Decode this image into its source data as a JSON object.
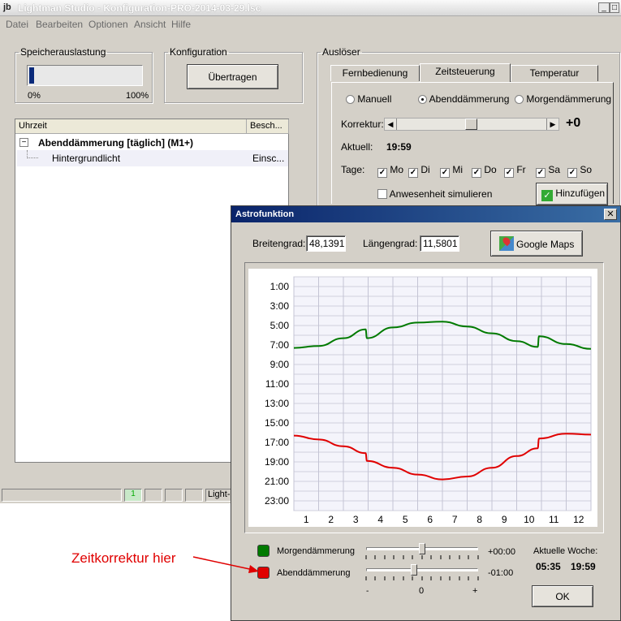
{
  "app": {
    "title": "Lightman Studio - Konfiguration-PRO-2014-03-29.lsc",
    "logo": "jb"
  },
  "menu": [
    "Datei",
    "Bearbeiten",
    "Optionen",
    "Ansicht",
    "Hilfe"
  ],
  "memory": {
    "legend": "Speicherauslastung",
    "min": "0%",
    "max": "100%",
    "usage": 0.04
  },
  "config": {
    "legend": "Konfiguration",
    "button": "Übertragen"
  },
  "list": {
    "headers": [
      "Uhrzeit",
      "Besch..."
    ],
    "group": "Abenddämmerung [täglich] (M1+)",
    "collapse": "−",
    "row": {
      "name": "Hintergrundlicht",
      "desc": "Einsc..."
    }
  },
  "status": {
    "indicator": "1",
    "text": "Light-I"
  },
  "trigger": {
    "legend": "Auslöser",
    "tabs": [
      "Fernbedienung",
      "Zeitsteuerung",
      "Temperatur"
    ],
    "modes": [
      "Manuell",
      "Abenddämmerung",
      "Morgendämmerung"
    ],
    "correction_label": "Korrektur:",
    "correction_value": "+0",
    "current_label": "Aktuell:",
    "current_value": "19:59",
    "days_label": "Tage:",
    "days": [
      "Mo",
      "Di",
      "Mi",
      "Do",
      "Fr",
      "Sa",
      "So"
    ],
    "simulate": "Anwesenheit simulieren",
    "add_button": "Hinzufügen"
  },
  "dialog": {
    "title": "Astrofunktion",
    "lat_label": "Breitengrad:",
    "lat": "48,1391",
    "lon_label": "Längengrad:",
    "lon": "11,5801",
    "maps_button": "Google Maps",
    "legend_morning": "Morgendämmerung",
    "legend_evening": "Abenddämmerung",
    "morning_offset": "+00:00",
    "evening_offset": "-01:00",
    "scale_minus": "-",
    "scale_zero": "0",
    "scale_plus": "+",
    "week_label": "Aktuelle Woche:",
    "week_morning": "05:35",
    "week_evening": "19:59",
    "ok": "OK"
  },
  "annotation": "Zeitkorrektur hier",
  "colors": {
    "morning": "#007a00",
    "evening": "#e00000",
    "annotation": "#e00000",
    "titlebar": "#0a246a"
  },
  "chart_data": {
    "type": "line",
    "x_ticks": [
      1,
      2,
      3,
      4,
      5,
      6,
      7,
      8,
      9,
      10,
      11,
      12
    ],
    "y_ticks": [
      "1:00",
      "3:00",
      "5:00",
      "7:00",
      "9:00",
      "11:00",
      "13:00",
      "15:00",
      "17:00",
      "19:00",
      "21:00",
      "23:00"
    ],
    "ylim": [
      0,
      24
    ],
    "xlim": [
      0.5,
      12.5
    ],
    "series": [
      {
        "key": "morning",
        "x": [
          0.5,
          1.5,
          2.5,
          3.4,
          3.45,
          4.5,
          5.5,
          6.5,
          7.5,
          8.5,
          9.5,
          10.35,
          10.4,
          11.5,
          12.5
        ],
        "y": [
          7.3,
          7.1,
          6.3,
          5.4,
          6.3,
          5.2,
          4.7,
          4.6,
          5.1,
          5.8,
          6.6,
          7.2,
          6.1,
          6.9,
          7.4
        ]
      },
      {
        "key": "evening",
        "x": [
          0.5,
          1.5,
          2.5,
          3.4,
          3.45,
          4.5,
          5.5,
          6.5,
          7.5,
          8.5,
          9.5,
          10.35,
          10.4,
          11.5,
          12.5
        ],
        "y": [
          16.3,
          16.7,
          17.4,
          18.1,
          18.9,
          19.6,
          20.3,
          20.8,
          20.5,
          19.6,
          18.4,
          17.6,
          16.6,
          16.1,
          16.2
        ]
      }
    ]
  }
}
